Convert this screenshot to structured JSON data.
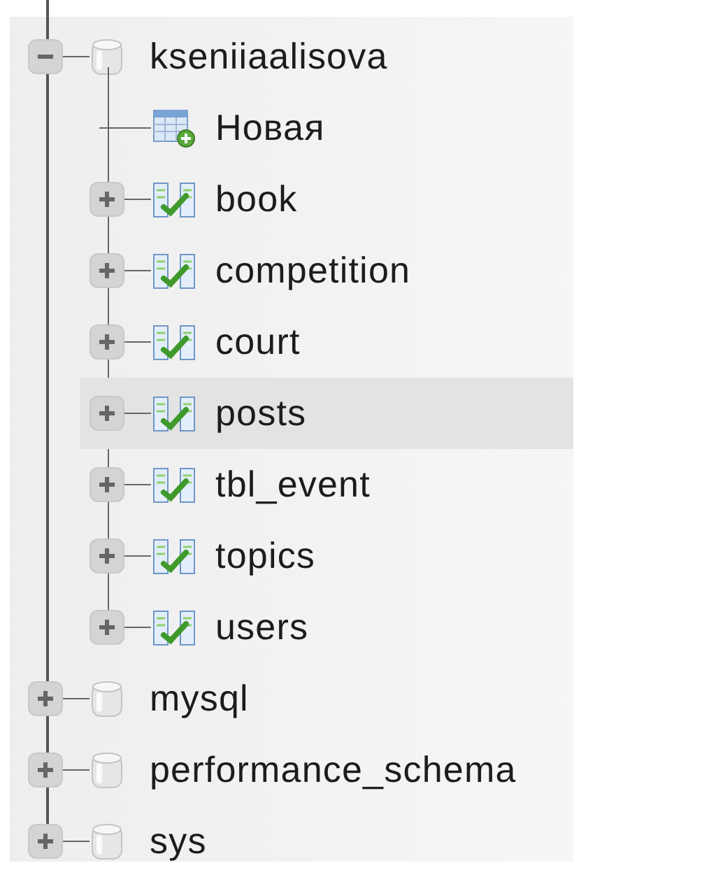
{
  "tree": [
    {
      "label": "kseniiaalisova",
      "kind": "database",
      "expanded": true,
      "children": [
        {
          "label": "Новая",
          "kind": "new"
        },
        {
          "label": "book",
          "kind": "table",
          "expanded": false,
          "highlighted": false
        },
        {
          "label": "competition",
          "kind": "table",
          "expanded": false,
          "highlighted": false
        },
        {
          "label": "court",
          "kind": "table",
          "expanded": false,
          "highlighted": false
        },
        {
          "label": "posts",
          "kind": "table",
          "expanded": false,
          "highlighted": true
        },
        {
          "label": "tbl_event",
          "kind": "table",
          "expanded": false,
          "highlighted": false
        },
        {
          "label": "topics",
          "kind": "table",
          "expanded": false,
          "highlighted": false
        },
        {
          "label": "users",
          "kind": "table",
          "expanded": false,
          "highlighted": false
        }
      ]
    },
    {
      "label": "mysql",
      "kind": "database",
      "expanded": false
    },
    {
      "label": "performance_schema",
      "kind": "database",
      "expanded": false
    },
    {
      "label": "sys",
      "kind": "database",
      "expanded": false
    }
  ]
}
